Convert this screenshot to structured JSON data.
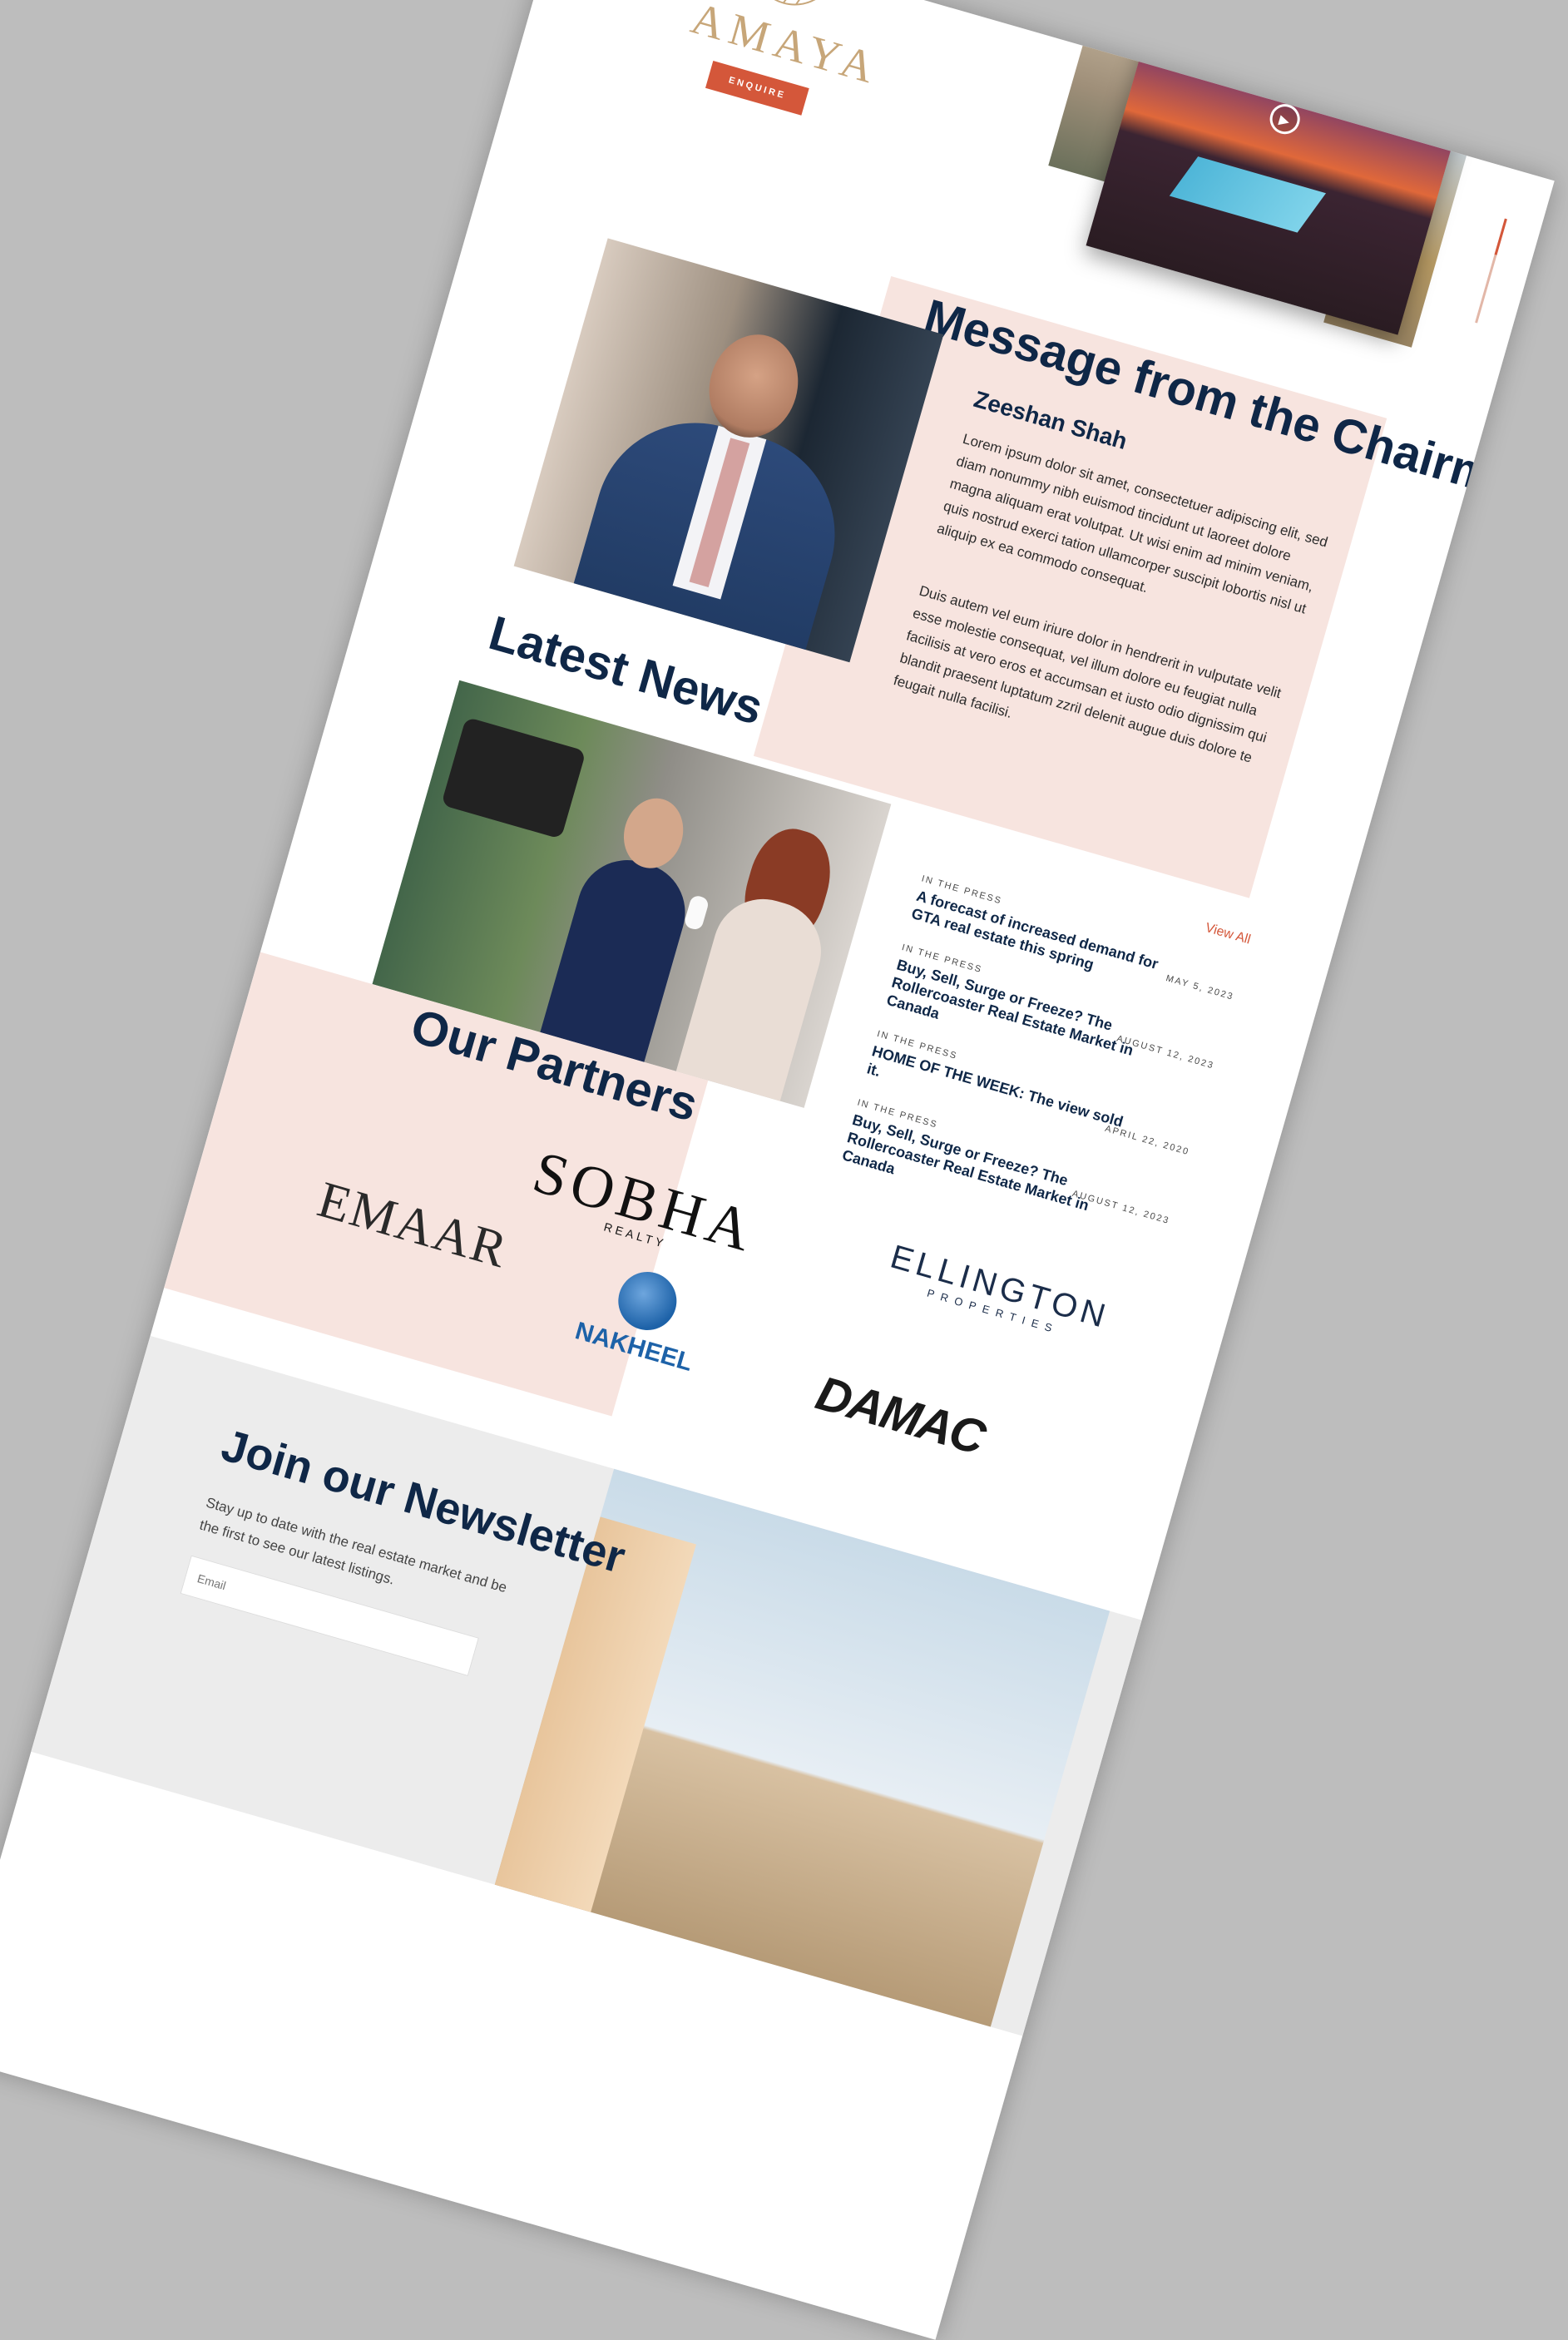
{
  "brand": {
    "logo_text": "AMAYA",
    "enquire_label": "ENQUIRE",
    "accent": "#d4573a",
    "navy": "#0f2747",
    "pink": "#f7e4df"
  },
  "hero": {
    "play_icon": "play-icon"
  },
  "chairman": {
    "title": "Message from the Chairman",
    "name": "Zeeshan Shah",
    "para1": "Lorem ipsum dolor sit amet, consectetuer adipiscing elit, sed diam nonummy nibh euismod tincidunt ut laoreet dolore magna aliquam erat volutpat. Ut wisi enim ad minim veniam, quis nostrud exerci tation ullamcorper suscipit lobortis nisl ut aliquip ex ea commodo consequat.",
    "para2": "Duis autem vel eum iriure dolor in hendrerit in vulputate velit esse molestie consequat, vel illum dolore eu feugiat nulla facilisis at vero eros et accumsan et iusto odio dignissim qui blandit praesent luptatum zzril delenit augue duis dolore te feugait nulla facilisi."
  },
  "news": {
    "title": "Latest News",
    "view_all": "View All",
    "items": [
      {
        "category": "IN THE PRESS",
        "headline": "A forecast of increased demand for GTA real estate this spring",
        "date": "MAY 5, 2023"
      },
      {
        "category": "IN THE PRESS",
        "headline": "Buy, Sell, Surge or Freeze? The Rollercoaster Real Estate Market in Canada",
        "date": "AUGUST 12, 2023"
      },
      {
        "category": "IN THE PRESS",
        "headline": "HOME OF THE WEEK: The view sold it.",
        "date": "APRIL 22, 2020"
      },
      {
        "category": "IN THE PRESS",
        "headline": "Buy, Sell, Surge or Freeze? The Rollercoaster Real Estate Market in Canada",
        "date": "AUGUST 12, 2023"
      }
    ]
  },
  "partners": {
    "title": "Our Partners",
    "sobha": "SOBHA",
    "sobha_sub": "REALTY",
    "ellington": "ELLINGTON",
    "ellington_sub": "PROPERTIES",
    "emaar": "EMAAR",
    "nakheel": "NAKHEEL",
    "damac": "DAMAC"
  },
  "newsletter": {
    "title": "Join our Newsletter",
    "text": "Stay up to date with the real estate market and be the first to see our latest listings.",
    "input_placeholder": "Email"
  }
}
